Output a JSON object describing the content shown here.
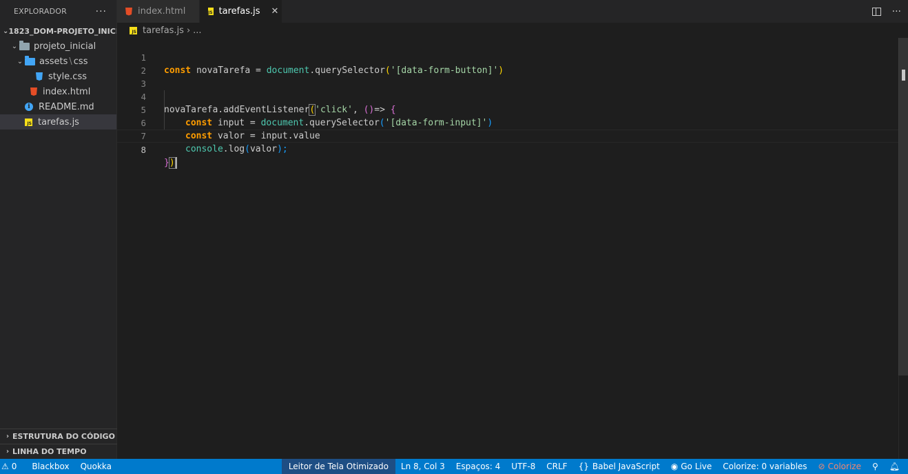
{
  "sidebar": {
    "title": "EXPLORADOR",
    "more": "···",
    "root": "1823_DOM-PROJETO_INICI...",
    "tree": [
      {
        "label": "projeto_inicial",
        "type": "folder"
      },
      {
        "label": "assets",
        "sep": "\\",
        "label2": "css",
        "type": "folder-blue"
      },
      {
        "label": "style.css",
        "type": "css"
      },
      {
        "label": "index.html",
        "type": "html"
      },
      {
        "label": "README.md",
        "type": "info"
      },
      {
        "label": "tarefas.js",
        "type": "js"
      }
    ],
    "outline": "ESTRUTURA DO CÓDIGO",
    "timeline": "LINHA DO TEMPO"
  },
  "tabs": [
    {
      "label": "index.html"
    },
    {
      "label": "tarefas.js",
      "close": "✕"
    }
  ],
  "breadcrumb": {
    "file": "tarefas.js",
    "sep": "›",
    "rest": "..."
  },
  "editor": {
    "line_numbers": [
      "1",
      "2",
      "3",
      "4",
      "5",
      "6",
      "7",
      "8"
    ],
    "code": {
      "l1": {
        "kw": "const",
        "name": " novaTarefa = ",
        "obj": "document",
        "method": ".querySelector",
        "open": "(",
        "str": "'[data-form-button]'",
        "close": ")"
      },
      "l4": {
        "name": "novaTarefa.addEventListener",
        "open": "(",
        "str": "'click'",
        "mid": ", ",
        "p1": "()",
        "arrow": "=> ",
        "brace": "{"
      },
      "l5": {
        "kw": "const",
        "name": " input = ",
        "obj": "document",
        "method": ".querySelector",
        "open": "(",
        "str": "'[data-form-input]'",
        "close": ")"
      },
      "l6": {
        "kw": "const",
        "name": " valor = input.value"
      },
      "l7": {
        "obj": "console",
        "method": ".log",
        "open": "(",
        "arg": "valor",
        "close": ");"
      },
      "l8": {
        "brace": "}",
        "paren": ")"
      }
    }
  },
  "status": {
    "warnings": "0",
    "blackbox": "Blackbox",
    "quokka": "Quokka",
    "reader": "Leitor de Tela Otimizado",
    "position": "Ln 8, Col 3",
    "spaces": "Espaços: 4",
    "encoding": "UTF-8",
    "eol": "CRLF",
    "language": "Babel JavaScript",
    "golive": "Go Live",
    "colorize_vars": "Colorize: 0 variables",
    "colorize": "Colorize"
  }
}
